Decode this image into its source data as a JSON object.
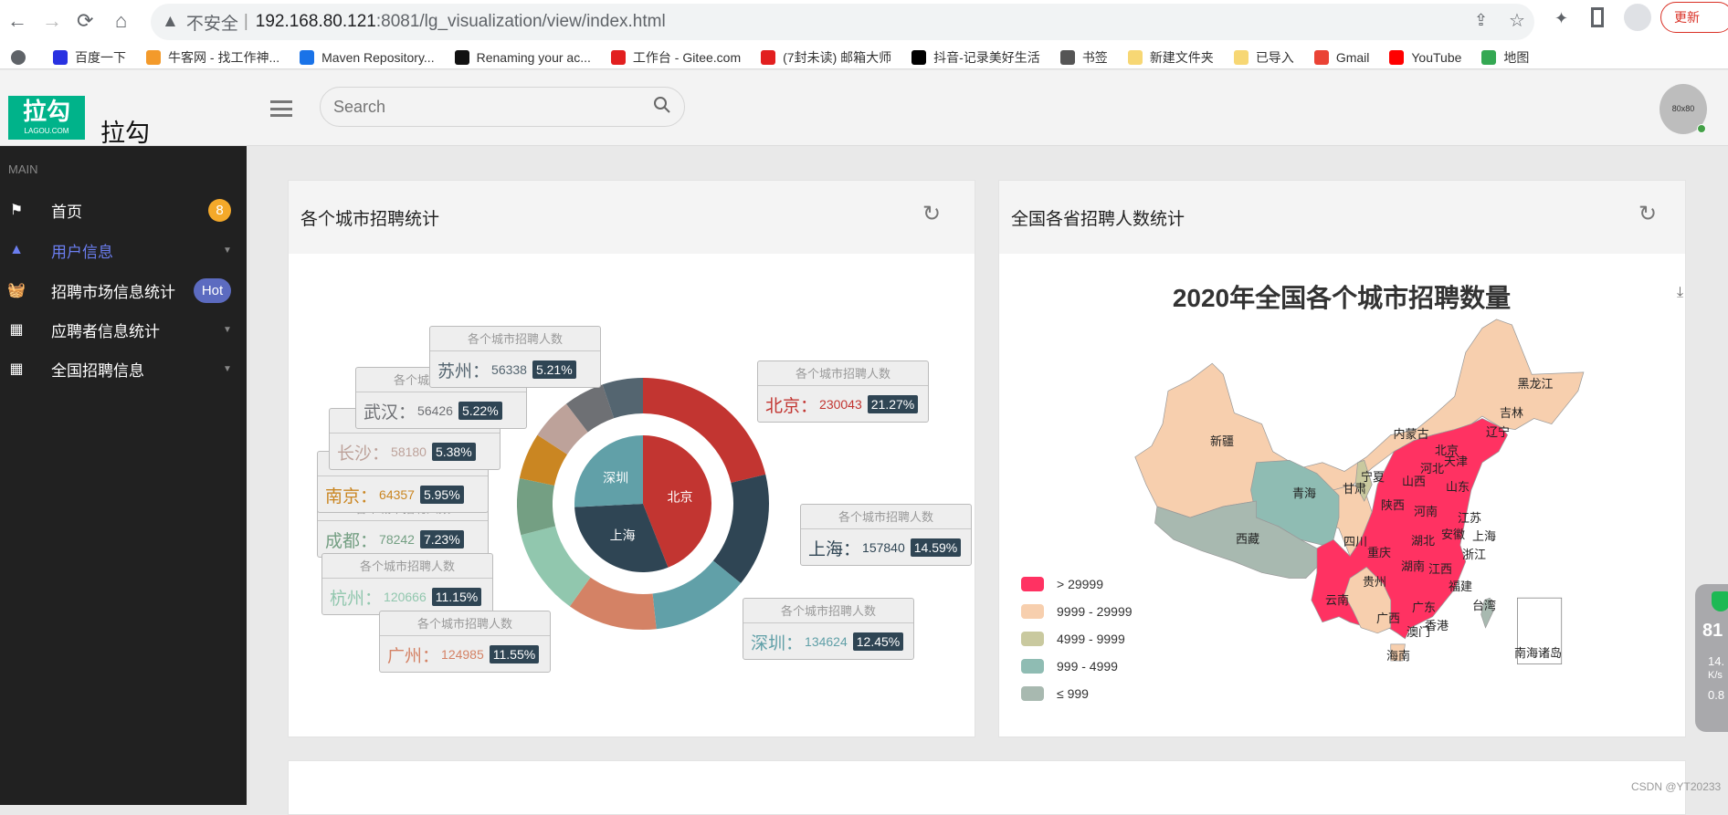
{
  "browser": {
    "back": "←",
    "forward": "→",
    "reload": "⟳",
    "home": "⌂",
    "insecure": "不安全",
    "url_host": "192.168.80.121",
    "url_path": ":8081/lg_visualization/view/index.html",
    "update": "更新",
    "bookmarks": [
      {
        "label": "百度一下",
        "color": "#2932e1"
      },
      {
        "label": "牛客网 - 找工作神...",
        "color": "#f39a2b"
      },
      {
        "label": "Maven Repository...",
        "color": "#1a73e8"
      },
      {
        "label": "Renaming your ac...",
        "color": "#111"
      },
      {
        "label": "工作台 - Gitee.com",
        "color": "#e21f1f"
      },
      {
        "label": "(7封未读) 邮箱大师",
        "color": "#e21f1f"
      },
      {
        "label": "抖音-记录美好生活",
        "color": "#000"
      },
      {
        "label": "书签",
        "color": "#555"
      },
      {
        "label": "新建文件夹",
        "color": "#f7d774"
      },
      {
        "label": "已导入",
        "color": "#f7d774"
      },
      {
        "label": "Gmail",
        "color": "#ea4335"
      },
      {
        "label": "YouTube",
        "color": "#ff0000"
      },
      {
        "label": "地图",
        "color": "#34a853"
      }
    ]
  },
  "header": {
    "logo_text": "拉勾",
    "logo_sub": "LAGOU.COM",
    "brand": "拉勾",
    "search_placeholder": "Search",
    "avatar": "80x80"
  },
  "sidebar": {
    "section": "MAIN",
    "items": [
      {
        "label": "首页",
        "icon": "flag-icon",
        "badge": "8",
        "badge_color": "#f4a92a"
      },
      {
        "label": "用户信息",
        "icon": "mountain-icon",
        "active": true,
        "caret": true
      },
      {
        "label": "招聘市场信息统计",
        "icon": "basket-icon",
        "badge": "Hot",
        "badge_color": "#5c6bc0"
      },
      {
        "label": "应聘者信息统计",
        "icon": "grid-icon",
        "caret": true
      },
      {
        "label": "全国招聘信息",
        "icon": "grid-icon",
        "caret": true
      }
    ]
  },
  "card_city": {
    "title": "各个城市招聘统计"
  },
  "card_province": {
    "title": "全国各省招聘人数统计"
  },
  "chart_data": [
    {
      "type": "pie",
      "variant": "donut-with-inner-pie",
      "series_label": "各个城市招聘人数",
      "outer": [
        {
          "name": "北京",
          "value": 230043,
          "pct": "21.27%",
          "color": "#c23531"
        },
        {
          "name": "上海",
          "value": 157840,
          "pct": "14.59%",
          "color": "#2f4554"
        },
        {
          "name": "深圳",
          "value": 134624,
          "pct": "12.45%",
          "color": "#61a0a8"
        },
        {
          "name": "广州",
          "value": 124985,
          "pct": "11.55%",
          "color": "#d48265"
        },
        {
          "name": "杭州",
          "value": 120666,
          "pct": "11.15%",
          "color": "#91c7ae"
        },
        {
          "name": "成都",
          "value": 78242,
          "pct": "7.23%",
          "color": "#749f83"
        },
        {
          "name": "南京",
          "value": 64357,
          "pct": "5.95%",
          "color": "#ca8622"
        },
        {
          "name": "长沙",
          "value": 58180,
          "pct": "5.38%",
          "color": "#bda29a"
        },
        {
          "name": "武汉",
          "value": 56426,
          "pct": "5.22%",
          "color": "#6e7074"
        },
        {
          "name": "苏州",
          "value": 56338,
          "pct": "5.21%",
          "color": "#546570"
        }
      ],
      "inner": [
        {
          "name": "北京",
          "value": 230043,
          "color": "#c23531"
        },
        {
          "name": "上海",
          "value": 157840,
          "color": "#2f4554"
        },
        {
          "name": "深圳",
          "value": 134624,
          "color": "#61a0a8"
        }
      ]
    },
    {
      "type": "map",
      "title": "2020年全国各个城市招聘数量",
      "legend": [
        {
          "label": "> 29999",
          "color": "#ff3262"
        },
        {
          "label": "9999 - 29999",
          "color": "#f7cfae"
        },
        {
          "label": "4999 - 9999",
          "color": "#c9c99f"
        },
        {
          "label": "999 - 4999",
          "color": "#8fbcb3"
        },
        {
          "label": "≤ 999",
          "color": "#a8b9b0"
        }
      ],
      "regions": [
        "黑龙江",
        "吉林",
        "内蒙古",
        "辽宁",
        "北京",
        "天津",
        "河北",
        "山西",
        "山东",
        "宁夏",
        "甘肃",
        "青海",
        "新疆",
        "陕西",
        "河南",
        "江苏",
        "西藏",
        "四川",
        "湖北",
        "安徽",
        "上海",
        "重庆",
        "浙江",
        "湖南",
        "江西",
        "贵州",
        "福建",
        "云南",
        "广东",
        "台湾",
        "广西",
        "香港",
        "澳门",
        "海南",
        "南海诸岛"
      ]
    }
  ],
  "widget": {
    "score": "81",
    "up": "14.",
    "down": "0.8",
    "unit": "K/s"
  },
  "watermark": "CSDN @YT20233"
}
